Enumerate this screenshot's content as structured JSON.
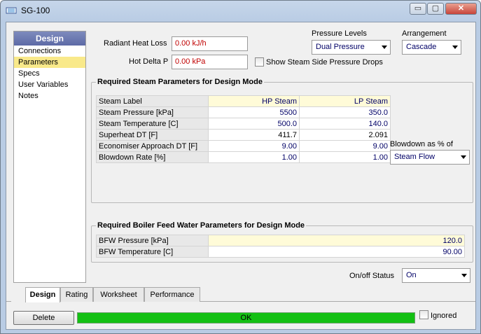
{
  "window": {
    "title": "SG-100",
    "icon": "steam-generator-icon",
    "min": "▭",
    "max": "▢",
    "close": "✕"
  },
  "nav": {
    "header": "Design",
    "items": [
      "Connections",
      "Parameters",
      "Specs",
      "User Variables",
      "Notes"
    ],
    "selected": 1
  },
  "params": {
    "radiant_label": "Radiant Heat Loss",
    "radiant_value": "0.00 kJ/h",
    "hotdelta_label": "Hot Delta P",
    "hotdelta_value": "0.00 kPa",
    "show_drops_label": "Show Steam Side Pressure Drops",
    "pressure_levels_label": "Pressure Levels",
    "pressure_levels_value": "Dual Pressure",
    "arrangement_label": "Arrangement",
    "arrangement_value": "Cascade"
  },
  "steam": {
    "title": "Required Steam Parameters for Design Mode",
    "header": [
      "Steam Label",
      "HP Steam",
      "LP Steam"
    ],
    "rows": [
      [
        "Steam Pressure [kPa]",
        "5500",
        "350.0"
      ],
      [
        "Steam Temperature [C]",
        "500.0",
        "140.0"
      ],
      [
        "Superheat DT [F]",
        "411.7",
        "2.091"
      ],
      [
        "Economiser Approach DT [F]",
        "9.00",
        "9.00"
      ],
      [
        "Blowdown Rate [%]",
        "1.00",
        "1.00"
      ]
    ],
    "blowdown_label": "Blowdown as % of",
    "blowdown_value": "Steam Flow"
  },
  "bfw": {
    "title": "Required Boiler Feed Water Parameters for Design Mode",
    "rows": [
      [
        "BFW Pressure [kPa]",
        "120.0"
      ],
      [
        "BFW Temperature [C]",
        "90.00"
      ]
    ]
  },
  "onoff": {
    "label": "On/off Status",
    "value": "On"
  },
  "tabs": [
    "Design",
    "Rating",
    "Worksheet",
    "Performance"
  ],
  "footer": {
    "delete": "Delete",
    "status": "OK",
    "ignored": "Ignored"
  }
}
